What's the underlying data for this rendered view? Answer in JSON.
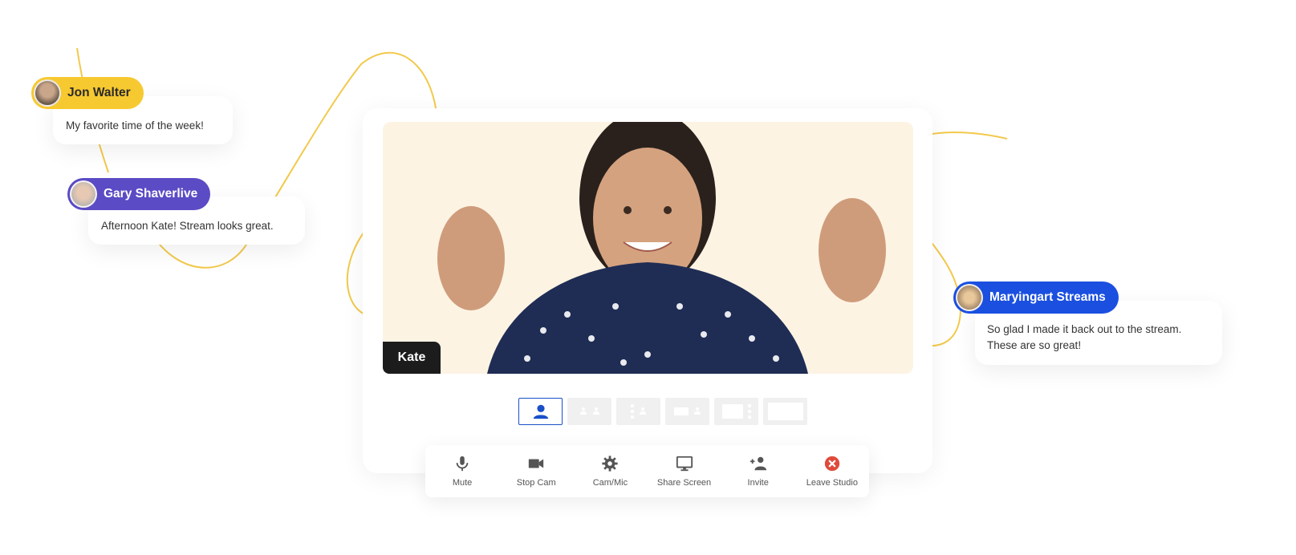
{
  "studio": {
    "presenter_name": "Kate",
    "layouts": [
      {
        "name": "solo",
        "active": true
      },
      {
        "name": "two-up",
        "active": false
      },
      {
        "name": "grid",
        "active": false
      },
      {
        "name": "side-by-side",
        "active": false
      },
      {
        "name": "screen-thumbs",
        "active": false
      },
      {
        "name": "full-screen",
        "active": false
      }
    ]
  },
  "toolbar": {
    "items": [
      {
        "label": "Mute",
        "icon": "microphone-icon"
      },
      {
        "label": "Stop Cam",
        "icon": "video-camera-icon"
      },
      {
        "label": "Cam/Mic",
        "icon": "gear-icon"
      },
      {
        "label": "Share Screen",
        "icon": "monitor-icon"
      },
      {
        "label": "Invite",
        "icon": "add-user-icon"
      },
      {
        "label": "Leave Studio",
        "icon": "close-circle-icon"
      }
    ]
  },
  "comments": [
    {
      "name": "Jon Walter",
      "message": "My favorite time of the week!",
      "color": "#f7c930",
      "text_color": "#2a2a2a"
    },
    {
      "name": "Gary Shaverlive",
      "message": "Afternoon Kate! Stream looks great.",
      "color": "#5b4bc4",
      "text_color": "#ffffff"
    },
    {
      "name": "Maryingart Streams",
      "message_lines": [
        "So glad I made it back out to the stream.",
        "These are so great!"
      ],
      "color": "#1a4fe0",
      "text_color": "#ffffff"
    }
  ],
  "colors": {
    "accent_line": "#f2c94c",
    "active_layout": "#1a4fc9",
    "leave": "#e04a3a",
    "video_bg": "#fdf3e3"
  }
}
